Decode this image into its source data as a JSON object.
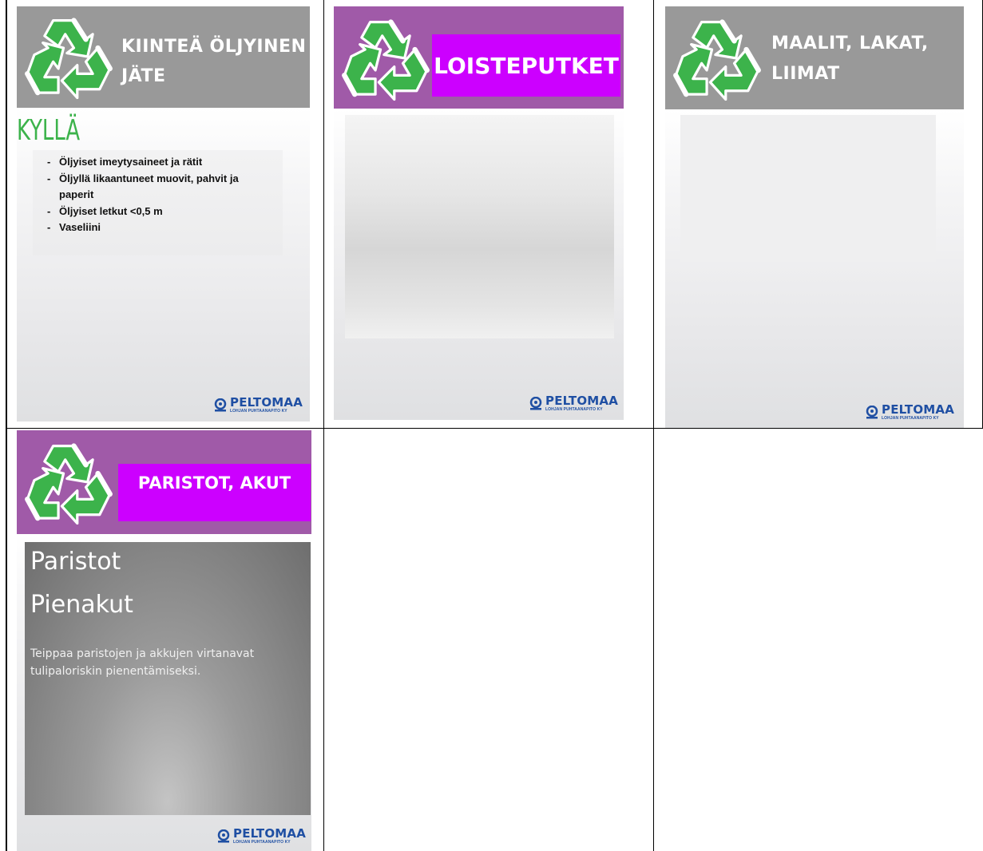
{
  "colors": {
    "gray_header": "#999999",
    "purple_header": "#a05aa8",
    "magenta_box": "#cc00ff",
    "green_recycle": "#3cb34b",
    "brand_blue": "#1f4fa3"
  },
  "icons": [
    "recycle-icon",
    "peltomaa-logo-icon"
  ],
  "brand": {
    "name": "PELTOMAA",
    "sub": "LOHJAN PUHTAANAPITO KY"
  },
  "cards": {
    "c1": {
      "title_line1": "KIINTEÄ ÖLJYINEN",
      "title_line2": "JÄTE",
      "heading": "KYLLÄ",
      "items": [
        "Öljyiset imeytysaineet ja rätit",
        "Öljyllä likaantuneet muovit, pahvit ja paperit",
        "Öljyiset letkut <0,5 m",
        "Vaseliini"
      ]
    },
    "c2": {
      "title": "LOISTEPUTKET"
    },
    "c3": {
      "title_line1": "MAALIT, LAKAT,",
      "title_line2": "LIIMAT"
    },
    "c4": {
      "title": "PARISTOT, AKUT",
      "heading1": "Paristot",
      "heading2": "Pienakut",
      "text": "Teippaa paristojen ja akkujen virtanavat tulipaloriskin pienentämiseksi."
    }
  }
}
